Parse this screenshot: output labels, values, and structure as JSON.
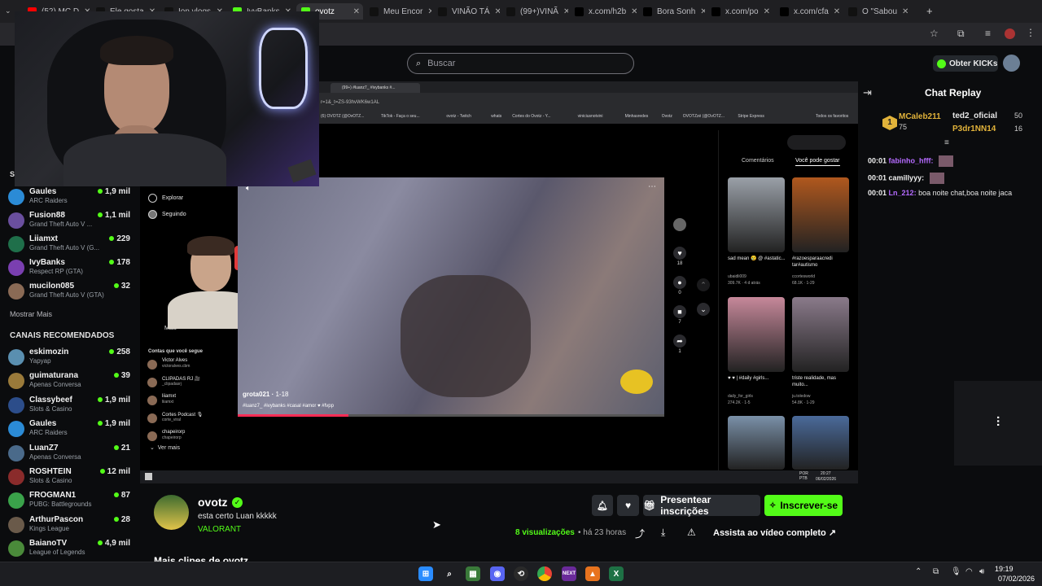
{
  "browser": {
    "tabs": [
      {
        "label": "(52) MC D",
        "color": "#ff0000"
      },
      {
        "label": "Ele gosta",
        "color": "#111111"
      },
      {
        "label": "Ion vlogs",
        "color": "#111111"
      },
      {
        "label": "IvyBanks",
        "color": "#53fc18"
      },
      {
        "label": "ovotz",
        "color": "#53fc18",
        "active": true
      },
      {
        "label": "Meu Encor",
        "color": "#111111"
      },
      {
        "label": "VINÃO TÁ",
        "color": "#111111"
      },
      {
        "label": "(99+)VINÃ",
        "color": "#111111"
      },
      {
        "label": "x.com/h2b",
        "color": "#000000"
      },
      {
        "label": "Bora Sonh",
        "color": "#000000"
      },
      {
        "label": "x.com/po",
        "color": "#000000"
      },
      {
        "label": "x.com/cfa",
        "color": "#000000"
      },
      {
        "label": "O \"Sabou",
        "color": "#111111"
      }
    ],
    "new_tab": "+"
  },
  "header": {
    "search_placeholder": "Buscar",
    "get_kicks": "Obter KICKs"
  },
  "sidebar": {
    "section_following": "S",
    "following": [
      {
        "name": "Gaules",
        "category": "ARC Raiders",
        "viewers": "1,9 mil",
        "color": "#2b8bd6"
      },
      {
        "name": "Fusion88",
        "category": "Grand Theft Auto V ...",
        "viewers": "1,1 mil",
        "color": "#6a4f9e"
      },
      {
        "name": "Liiamxt",
        "category": "Grand Theft Auto V (G...",
        "viewers": "229",
        "color": "#1f6f4a"
      },
      {
        "name": "IvyBanks",
        "category": "Respect RP (GTA)",
        "viewers": "178",
        "color": "#7a3fb0"
      },
      {
        "name": "mucilon085",
        "category": "Grand Theft Auto V (GTA)",
        "viewers": "32",
        "color": "#8a6a55"
      }
    ],
    "show_more": "Mostrar Mais",
    "section_recommended": "CANAIS RECOMENDADOS",
    "recommended": [
      {
        "name": "eskimozin",
        "category": "Yapyap",
        "viewers": "258",
        "color": "#5a8fb0"
      },
      {
        "name": "guimaturana",
        "category": "Apenas Conversa",
        "viewers": "39",
        "color": "#9a7a3a"
      },
      {
        "name": "Classybeef",
        "category": "Slots & Casino",
        "viewers": "1,9 mil",
        "color": "#2c4d8a"
      },
      {
        "name": "Gaules",
        "category": "ARC Raiders",
        "viewers": "1,9 mil",
        "color": "#2b8bd6"
      },
      {
        "name": "LuanZ7",
        "category": "Apenas Conversa",
        "viewers": "21",
        "color": "#4a6a8a"
      },
      {
        "name": "ROSHTEIN",
        "category": "Slots & Casino",
        "viewers": "12 mil",
        "color": "#8a2b2b"
      },
      {
        "name": "FROGMAN1",
        "category": "PUBG: Battlegrounds",
        "viewers": "87",
        "color": "#3aa24a"
      },
      {
        "name": "ArthurPascon",
        "category": "Kings League",
        "viewers": "28",
        "color": "#6a5a4a"
      },
      {
        "name": "BaianoTV",
        "category": "League of Legends",
        "viewers": "4,9 mil",
        "color": "#4a8a3a"
      }
    ]
  },
  "embedded": {
    "tab_label": "(99+) #luanz7_ #ivybanks #...",
    "url": "r=1&_t=ZS-93hvWK6w1AL",
    "bookmarks": [
      "(6) OVOTZ (@OvOTZ...",
      "TikTok - Faça o seu...",
      "ovotz - Twitch",
      "whats",
      "Cortes do Ovotz - Y...",
      "viniciusnotvini",
      "Minhasredes",
      "Ovotz",
      "OVOTZzé (@OvOTZ...",
      "Stripe Express",
      "Todos os favoritos"
    ],
    "tiktok_nav": [
      "Explorar",
      "Seguindo"
    ],
    "more_label": "Mais",
    "following_title": "Contas que você segue",
    "following": [
      {
        "name": "Victor Alves",
        "user": "victoralves.cbm"
      },
      {
        "name": "CLIPADAS RJ 🎥",
        "user": "_clipadasrj"
      },
      {
        "name": "liiamxt",
        "user": "liiamxt"
      },
      {
        "name": "Cortes Podcast 🎙",
        "user": "corte_viral"
      },
      {
        "name": "chapeirorp",
        "user": "chapeirorp"
      }
    ],
    "see_more": "Ver mais",
    "video_author": "grota021",
    "video_date": "1-18",
    "video_tags": "#luanz7_ #ivybanks #casal #amor ♥ #fvpp",
    "progress_fraction": 0.26,
    "rail": [
      {
        "icon": "♥",
        "count": "18"
      },
      {
        "icon": "●",
        "count": "0"
      },
      {
        "icon": "■",
        "count": "7"
      },
      {
        "icon": "➦",
        "count": "1"
      }
    ],
    "tab_comments": "Comentários",
    "tab_suggest": "Você pode gostar",
    "suggestions": [
      {
        "caption": "sad mean 😢 @ #astatic...",
        "user": "ubaidli009",
        "stats": "309.7K · 4 d atrás",
        "color": "#9aa0a8"
      },
      {
        "caption": "#razoesparaacredi tar#autismo",
        "user": "ccortesworld",
        "stats": "68.1K · 1-29",
        "color": "#b0581e"
      },
      {
        "caption": "♥ ♥ | #daily #girls...",
        "user": "daily_for_girls",
        "stats": "274.2K · 1-5",
        "color": "#c6889a"
      },
      {
        "caption": "triste realidade, mas muito...",
        "user": "ju.toledow",
        "stats": "54.8K · 1-29",
        "color": "#8a7a8a"
      },
      {
        "caption": "",
        "user": "",
        "stats": "",
        "color": "#7a90a8"
      },
      {
        "caption": "",
        "user": "",
        "stats": "",
        "color": "#4a6a9a"
      }
    ],
    "taskbar_lang": "POR PTB",
    "taskbar_time": "20:27",
    "taskbar_date": "06/02/2026"
  },
  "chat": {
    "title": "Chat Replay",
    "leaderboard": [
      {
        "rank": "1",
        "name": "MCaleb211",
        "value": "75"
      },
      {
        "name": "ted2_oficial",
        "value": "50"
      },
      {
        "name": "P3dr1NN14",
        "value": "16"
      }
    ],
    "messages": [
      {
        "time": "00:01",
        "user": "fabinho_hfff:",
        "text": "",
        "color": "#b56bff"
      },
      {
        "time": "00:01",
        "user": "camillyyy:",
        "text": "",
        "color": "#f1f1f1"
      },
      {
        "time": "00:01",
        "user": "Ln_212:",
        "text": "boa noite chat,boa noite jaca",
        "color": "#b56bff"
      }
    ]
  },
  "info": {
    "channel": "ovotz",
    "title": "esta certo Luan kkkkk",
    "category": "VALORANT",
    "btn_gift": "Presentear inscrições",
    "btn_subscribe": "Inscrever-se",
    "views_count": "8",
    "views_label": "visualizações",
    "ago": "há 23 horas",
    "watch_full": "Assista ao vídeo completo",
    "more_clips": "Mais clipes de ovotz"
  },
  "windows": {
    "time": "19:19",
    "date": "07/02/2026"
  },
  "colors": {
    "accent": "#53fc18",
    "bg": "#0b0c0e",
    "tiktok_red": "#fe2c55"
  }
}
